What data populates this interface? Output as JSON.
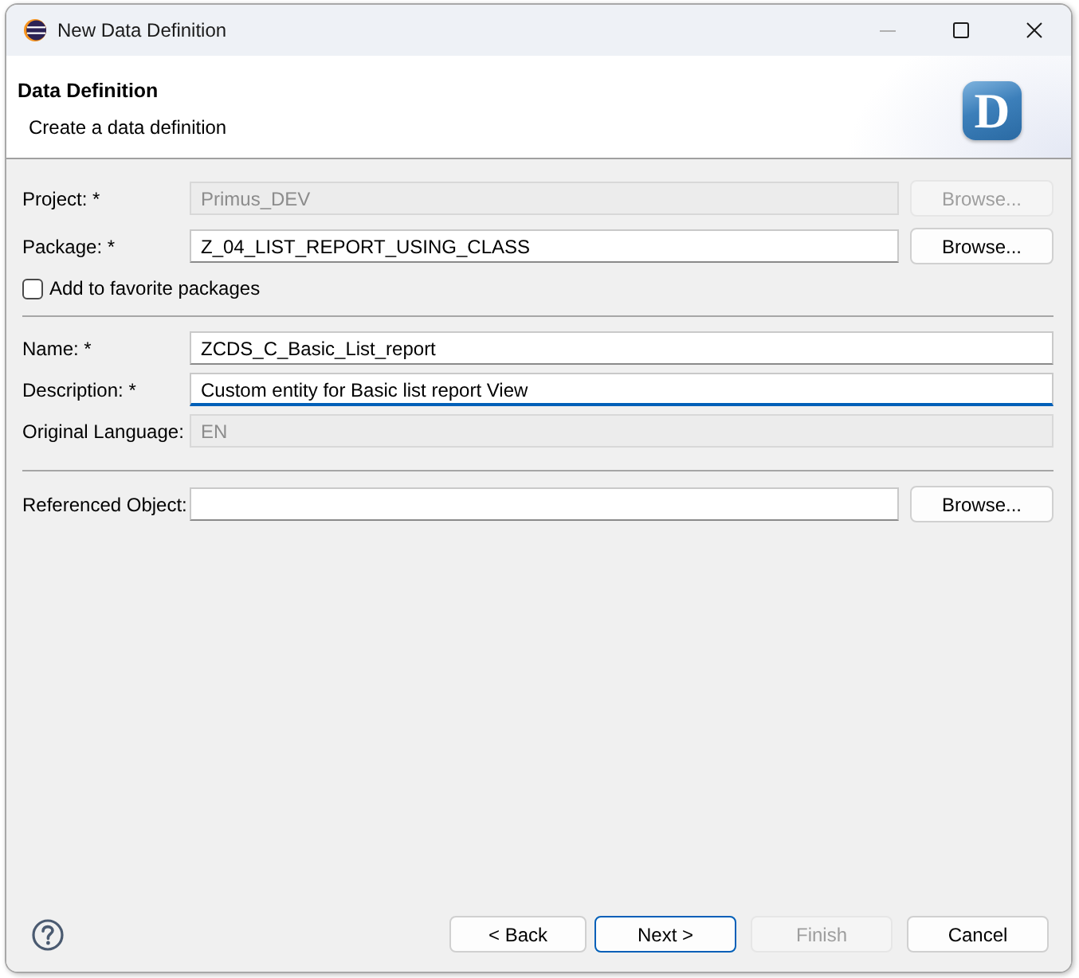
{
  "window": {
    "title": "New Data Definition"
  },
  "header": {
    "title": "Data Definition",
    "description": "Create a data definition",
    "logo_letter": "D"
  },
  "sections": [
    {
      "rows": [
        {
          "kind": "field",
          "label": "Project: *",
          "value": "Primus_DEV",
          "disabled": true,
          "focused": false,
          "button": {
            "label": "Browse...",
            "disabled": true
          }
        },
        {
          "kind": "field",
          "label": "Package: *",
          "value": "Z_04_LIST_REPORT_USING_CLASS",
          "disabled": false,
          "focused": false,
          "button": {
            "label": "Browse...",
            "disabled": false
          }
        },
        {
          "kind": "checkbox",
          "label": "Add to favorite packages",
          "checked": false
        }
      ]
    },
    {
      "rows": [
        {
          "kind": "field",
          "label": "Name: *",
          "value": "ZCDS_C_Basic_List_report",
          "disabled": false,
          "focused": false
        },
        {
          "kind": "field",
          "label": "Description: *",
          "value": "Custom entity for Basic list report View",
          "disabled": false,
          "focused": true
        },
        {
          "kind": "field",
          "label": "Original Language:",
          "value": "EN",
          "disabled": true,
          "focused": false
        }
      ]
    },
    {
      "rows": [
        {
          "kind": "field",
          "label": "Referenced Object:",
          "disabled": false,
          "focused": false,
          "button": {
            "label": "Browse...",
            "disabled": false
          }
        }
      ]
    }
  ],
  "buttons": [
    {
      "label": "< Back",
      "disabled": false,
      "focused": false
    },
    {
      "label": "Next >",
      "disabled": false,
      "focused": true
    },
    {
      "label": "Finish",
      "disabled": true,
      "focused": false
    },
    {
      "label": "Cancel",
      "disabled": false,
      "focused": false
    }
  ]
}
